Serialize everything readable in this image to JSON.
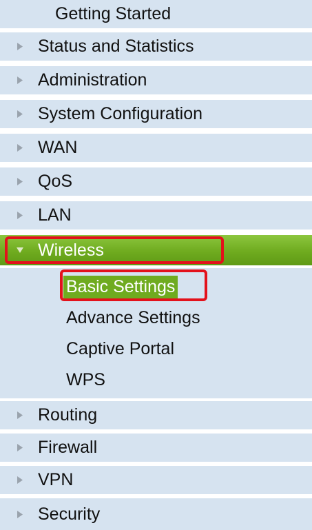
{
  "nav": {
    "top_label": "Getting Started",
    "items_before": [
      {
        "label": "Status and Statistics"
      },
      {
        "label": "Administration"
      },
      {
        "label": "System Configuration"
      },
      {
        "label": "WAN"
      },
      {
        "label": "QoS"
      },
      {
        "label": "LAN"
      }
    ],
    "active_item": {
      "label": "Wireless"
    },
    "submenu": [
      {
        "label": "Basic Settings",
        "selected": true
      },
      {
        "label": "Advance Settings"
      },
      {
        "label": "Captive Portal"
      },
      {
        "label": "WPS"
      }
    ],
    "items_after": [
      {
        "label": "Routing"
      },
      {
        "label": "Firewall"
      },
      {
        "label": "VPN"
      },
      {
        "label": "Security"
      }
    ]
  },
  "colors": {
    "row_bg": "#d6e3f0",
    "active_green": "#6fab1f",
    "highlight_red": "#e3111b",
    "text": "#111111"
  }
}
